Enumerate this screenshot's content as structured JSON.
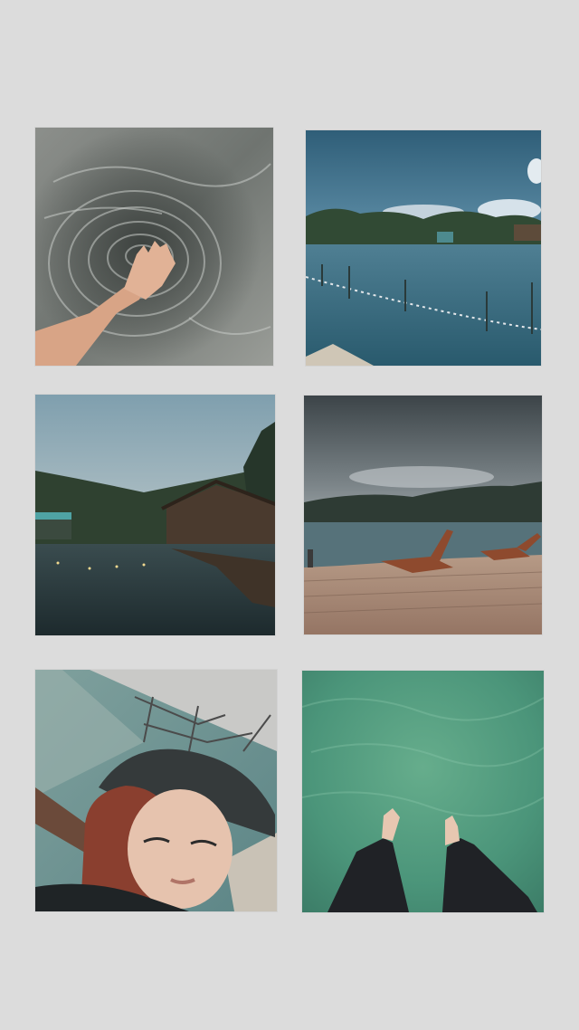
{
  "collage": {
    "background": "#dcdcdc",
    "photos": [
      {
        "subject": "hand-in-water-ripples"
      },
      {
        "subject": "lake-with-floating-rope-and-hills"
      },
      {
        "subject": "wooden-lodge-on-water-at-dusk"
      },
      {
        "subject": "deck-with-lounge-chairs-under-storm-clouds"
      },
      {
        "subject": "selfie-woman-in-cap-on-pier"
      },
      {
        "subject": "feet-dangling-over-green-water"
      }
    ]
  }
}
